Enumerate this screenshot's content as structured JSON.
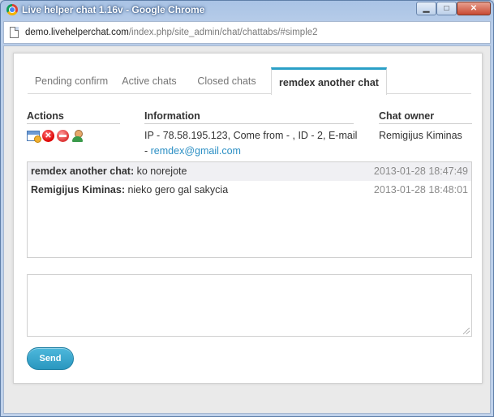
{
  "window": {
    "title": "Live helper chat 1.16v - Google Chrome",
    "url_host": "demo.livehelperchat.com",
    "url_path": "/index.php/site_admin/chat/chattabs/#simple2",
    "minimize_symbol": "▁",
    "maximize_symbol": "□",
    "close_symbol": "✕"
  },
  "tabs": [
    {
      "label": "Pending confirm",
      "active": false
    },
    {
      "label": "Active chats",
      "active": false
    },
    {
      "label": "Closed chats",
      "active": false
    },
    {
      "label": "remdex another chat",
      "active": true
    }
  ],
  "columns": {
    "actions_label": "Actions",
    "information_label": "Information",
    "owner_label": "Chat owner"
  },
  "actions": [
    {
      "icon": "window-icon"
    },
    {
      "icon": "close-chat-icon",
      "glyph": "✕"
    },
    {
      "icon": "block-icon"
    },
    {
      "icon": "transfer-user-icon"
    }
  ],
  "info": {
    "text": "IP - 78.58.195.123, Come from - , ID - 2, E-mail - ",
    "email": "remdex@gmail.com"
  },
  "owner": "Remigijus Kiminas",
  "messages": [
    {
      "author": "remdex another chat:",
      "text": " ko norejote",
      "time": "2013-01-28 18:47:49"
    },
    {
      "author": "Remigijus Kiminas:",
      "text": " nieko gero gal sakycia",
      "time": "2013-01-28 18:48:01"
    }
  ],
  "composer": {
    "placeholder": ""
  },
  "send_label": "Send",
  "colors": {
    "accent": "#2aa0c7",
    "link": "#2b8fc4",
    "title_bar": "#a9c3e5"
  }
}
